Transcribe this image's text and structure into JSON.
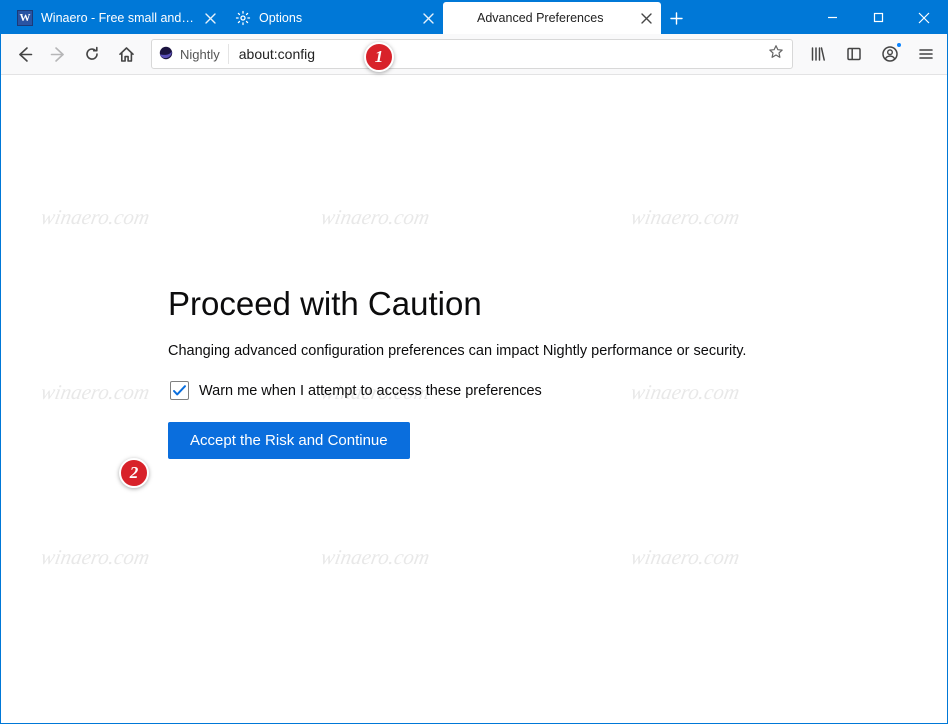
{
  "window": {
    "min_tooltip": "Minimize",
    "max_tooltip": "Maximize",
    "close_tooltip": "Close"
  },
  "tabs": [
    {
      "label": "Winaero - Free small and usef…",
      "active": false,
      "favicon": "winaero"
    },
    {
      "label": "Options",
      "active": false,
      "favicon": "gear"
    },
    {
      "label": "Advanced Preferences",
      "active": true,
      "favicon": "none"
    }
  ],
  "newtab_tooltip": "Open a new tab",
  "nav": {
    "back_tooltip": "Go back one page",
    "forward_tooltip": "Go forward one page",
    "reload_tooltip": "Reload current page",
    "home_tooltip": "Nightly Home Page",
    "identity_label": "Nightly",
    "url": "about:config",
    "bookmark_tooltip": "Bookmark this page",
    "library_tooltip": "View history, saved bookmarks, and more",
    "sidebar_tooltip": "Show sidebars",
    "account_tooltip": "Firefox account",
    "menu_tooltip": "Open application menu"
  },
  "page": {
    "title": "Proceed with Caution",
    "description": "Changing advanced configuration preferences can impact Nightly performance or security.",
    "checkbox_label": "Warn me when I attempt to access these preferences",
    "checkbox_checked": true,
    "accept_button": "Accept the Risk and Continue"
  },
  "annotations": {
    "badge1": "1",
    "badge2": "2"
  },
  "watermark_text": "winaero.com"
}
